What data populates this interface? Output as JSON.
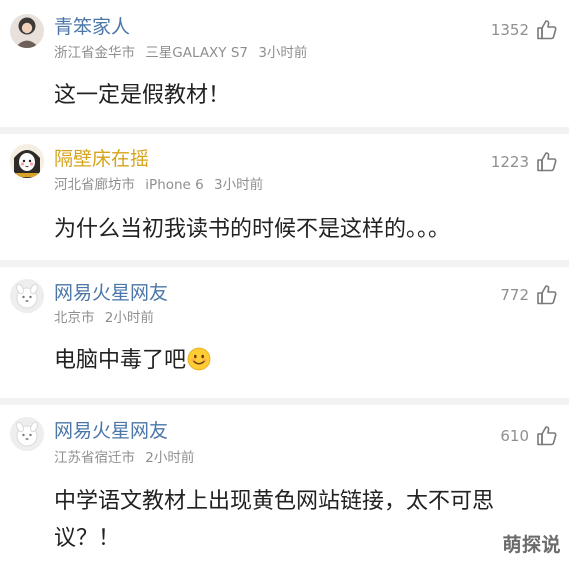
{
  "comments": [
    {
      "username": "青笨家人",
      "location": "浙江省金华市",
      "device": "三星GALAXY S7",
      "time": "3小时前",
      "likes": "1352",
      "content": "这一定是假教材！"
    },
    {
      "username": "隔壁床在摇",
      "location": "河北省廊坊市",
      "device": "iPhone 6",
      "time": "3小时前",
      "likes": "1223",
      "content": "为什么当初我读书的时候不是这样的。。。"
    },
    {
      "username": "网易火星网友",
      "location": "北京市",
      "time": "2小时前",
      "likes": "772",
      "content": "电脑中毒了吧"
    },
    {
      "username": "网易火星网友",
      "location": "江苏省宿迁市",
      "time": "2小时前",
      "likes": "610",
      "content": "中学语文教材上出现黄色网站链接，太不可思议？！"
    }
  ],
  "watermark": "萌探说",
  "colors": {
    "username_default": "#4a76a8",
    "username_highlight": "#d6a41a",
    "meta": "#8f8f8f",
    "text": "#222222",
    "divider": "#f2f2f2"
  },
  "icons": {
    "like": "thumbs-up-icon",
    "emoji": "smile-emoji-icon"
  }
}
